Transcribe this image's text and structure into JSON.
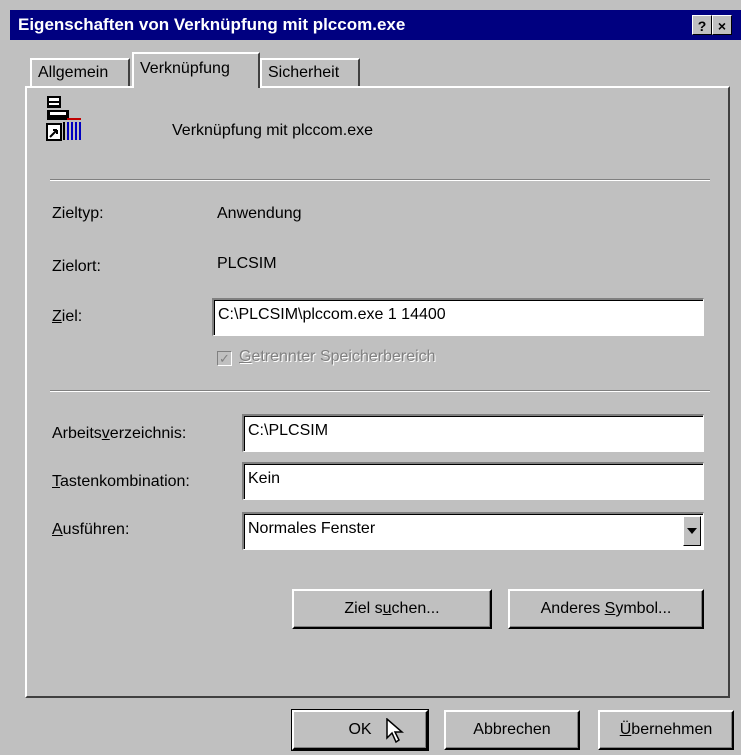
{
  "window": {
    "title": "Eigenschaften von Verknüpfung mit plccom.exe",
    "help_label": "?",
    "close_label": "×"
  },
  "tabs": [
    {
      "label": "Allgemein"
    },
    {
      "label": "Verknüpfung",
      "active": true
    },
    {
      "label": "Sicherheit"
    }
  ],
  "header": {
    "icon": "plcsim-shortcut-icon",
    "name": "Verknüpfung mit plccom.exe"
  },
  "target": {
    "type_label": "Zieltyp:",
    "type_value": "Anwendung",
    "location_label": "Zielort:",
    "location_value": "PLCSIM",
    "target_label_prefix": "",
    "target_label_u": "Z",
    "target_label_rest": "iel:",
    "target_value": "C:\\PLCSIM\\plccom.exe 1 14400",
    "separate_memory_u": "G",
    "separate_memory_rest": "etrennter Speicherbereich",
    "separate_memory_checked": true,
    "separate_memory_enabled": false
  },
  "settings": {
    "workdir_label_prefix": "Arbeits",
    "workdir_label_u": "v",
    "workdir_label_rest": "erzeichnis:",
    "workdir_value": "C:\\PLCSIM",
    "hotkey_label_u": "T",
    "hotkey_label_rest": "astenkombination:",
    "hotkey_value": "Kein",
    "run_label_u": "A",
    "run_label_rest": "usführen:",
    "run_value": "Normales Fenster"
  },
  "buttons": {
    "find_target_prefix": "Ziel s",
    "find_target_u": "u",
    "find_target_rest": "chen...",
    "change_icon_prefix": "Anderes ",
    "change_icon_u": "S",
    "change_icon_rest": "ymbol...",
    "ok": "OK",
    "cancel": "Abbrechen",
    "apply_u": "Ü",
    "apply_rest": "bernehmen"
  },
  "colors": {
    "titlebar": "#000080",
    "face": "#c0c0c0"
  }
}
